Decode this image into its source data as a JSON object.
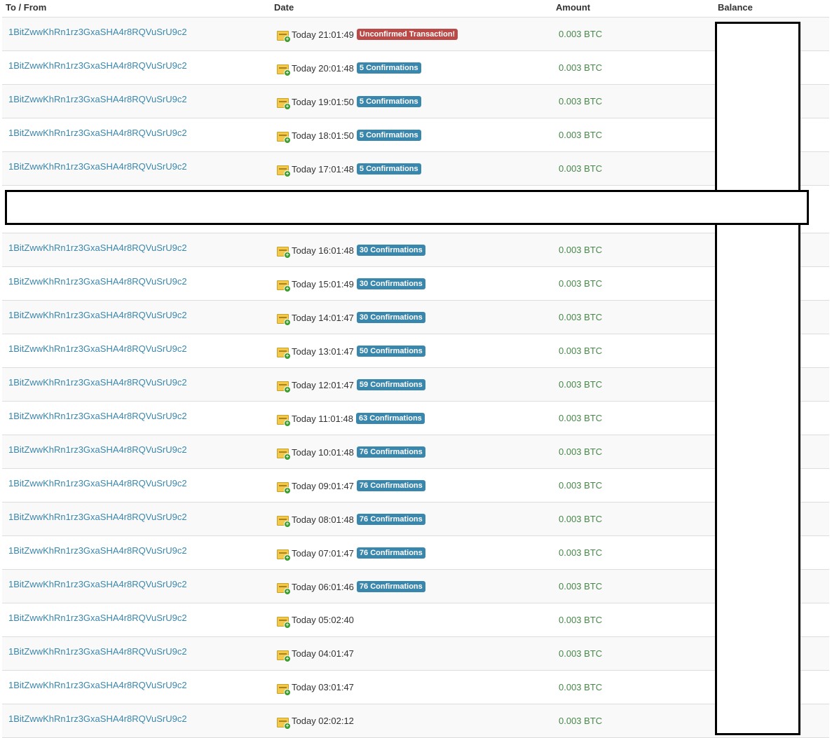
{
  "headers": {
    "to_from": "To / From",
    "date": "Date",
    "amount": "Amount",
    "balance": "Balance"
  },
  "rows_top": [
    {
      "address": "1BitZwwKhRn1rz3GxaSHA4r8RQVuSrU9c2",
      "date": "Today 21:01:49",
      "badge": "Unconfirmed Transaction!",
      "badge_type": "important",
      "amount": "0.003 BTC"
    },
    {
      "address": "1BitZwwKhRn1rz3GxaSHA4r8RQVuSrU9c2",
      "date": "Today 20:01:48",
      "badge": "5 Confirmations",
      "badge_type": "info",
      "amount": "0.003 BTC"
    },
    {
      "address": "1BitZwwKhRn1rz3GxaSHA4r8RQVuSrU9c2",
      "date": "Today 19:01:50",
      "badge": "5 Confirmations",
      "badge_type": "info",
      "amount": "0.003 BTC"
    },
    {
      "address": "1BitZwwKhRn1rz3GxaSHA4r8RQVuSrU9c2",
      "date": "Today 18:01:50",
      "badge": "5 Confirmations",
      "badge_type": "info",
      "amount": "0.003 BTC"
    },
    {
      "address": "1BitZwwKhRn1rz3GxaSHA4r8RQVuSrU9c2",
      "date": "Today 17:01:48",
      "badge": "5 Confirmations",
      "badge_type": "info",
      "amount": "0.003 BTC"
    }
  ],
  "rows_bottom": [
    {
      "address": "1BitZwwKhRn1rz3GxaSHA4r8RQVuSrU9c2",
      "date": "Today 16:01:48",
      "badge": "30 Confirmations",
      "badge_type": "info",
      "amount": "0.003 BTC"
    },
    {
      "address": "1BitZwwKhRn1rz3GxaSHA4r8RQVuSrU9c2",
      "date": "Today 15:01:49",
      "badge": "30 Confirmations",
      "badge_type": "info",
      "amount": "0.003 BTC"
    },
    {
      "address": "1BitZwwKhRn1rz3GxaSHA4r8RQVuSrU9c2",
      "date": "Today 14:01:47",
      "badge": "30 Confirmations",
      "badge_type": "info",
      "amount": "0.003 BTC"
    },
    {
      "address": "1BitZwwKhRn1rz3GxaSHA4r8RQVuSrU9c2",
      "date": "Today 13:01:47",
      "badge": "50 Confirmations",
      "badge_type": "info",
      "amount": "0.003 BTC"
    },
    {
      "address": "1BitZwwKhRn1rz3GxaSHA4r8RQVuSrU9c2",
      "date": "Today 12:01:47",
      "badge": "59 Confirmations",
      "badge_type": "info",
      "amount": "0.003 BTC"
    },
    {
      "address": "1BitZwwKhRn1rz3GxaSHA4r8RQVuSrU9c2",
      "date": "Today 11:01:48",
      "badge": "63 Confirmations",
      "badge_type": "info",
      "amount": "0.003 BTC"
    },
    {
      "address": "1BitZwwKhRn1rz3GxaSHA4r8RQVuSrU9c2",
      "date": "Today 10:01:48",
      "badge": "76 Confirmations",
      "badge_type": "info",
      "amount": "0.003 BTC"
    },
    {
      "address": "1BitZwwKhRn1rz3GxaSHA4r8RQVuSrU9c2",
      "date": "Today 09:01:47",
      "badge": "76 Confirmations",
      "badge_type": "info",
      "amount": "0.003 BTC"
    },
    {
      "address": "1BitZwwKhRn1rz3GxaSHA4r8RQVuSrU9c2",
      "date": "Today 08:01:48",
      "badge": "76 Confirmations",
      "badge_type": "info",
      "amount": "0.003 BTC"
    },
    {
      "address": "1BitZwwKhRn1rz3GxaSHA4r8RQVuSrU9c2",
      "date": "Today 07:01:47",
      "badge": "76 Confirmations",
      "badge_type": "info",
      "amount": "0.003 BTC"
    },
    {
      "address": "1BitZwwKhRn1rz3GxaSHA4r8RQVuSrU9c2",
      "date": "Today 06:01:46",
      "badge": "76 Confirmations",
      "badge_type": "info",
      "amount": "0.003 BTC"
    },
    {
      "address": "1BitZwwKhRn1rz3GxaSHA4r8RQVuSrU9c2",
      "date": "Today 05:02:40",
      "badge": "",
      "badge_type": "none",
      "amount": "0.003 BTC"
    },
    {
      "address": "1BitZwwKhRn1rz3GxaSHA4r8RQVuSrU9c2",
      "date": "Today 04:01:47",
      "badge": "",
      "badge_type": "none",
      "amount": "0.003 BTC"
    },
    {
      "address": "1BitZwwKhRn1rz3GxaSHA4r8RQVuSrU9c2",
      "date": "Today 03:01:47",
      "badge": "",
      "badge_type": "none",
      "amount": "0.003 BTC"
    },
    {
      "address": "1BitZwwKhRn1rz3GxaSHA4r8RQVuSrU9c2",
      "date": "Today 02:02:12",
      "badge": "",
      "badge_type": "none",
      "amount": "0.003 BTC"
    }
  ],
  "icons": {
    "transaction": "received-transaction-icon"
  },
  "colors": {
    "link": "#3a87ad",
    "amount": "#468847",
    "badge_info": "#3a87ad",
    "badge_important": "#b94a48"
  }
}
